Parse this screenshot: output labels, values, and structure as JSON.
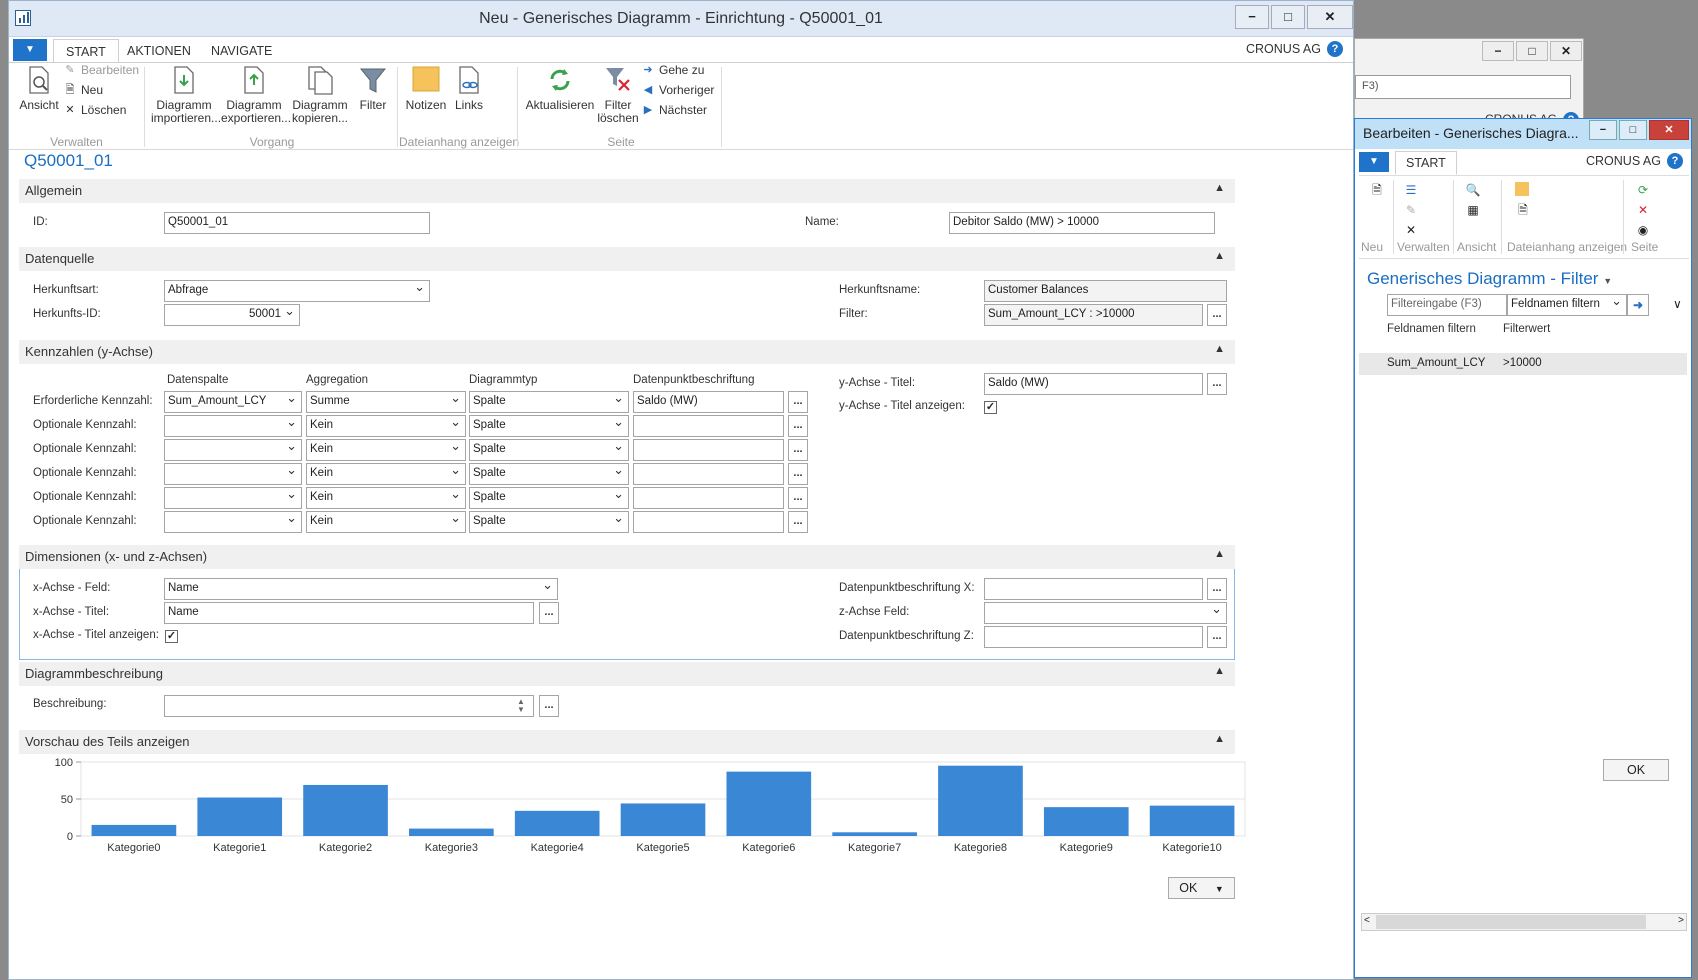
{
  "bg_window": {
    "search_placeholder": "F3)",
    "company": "CRONUS AG"
  },
  "main_window": {
    "title": "Neu - Generisches Diagramm - Einrichtung - Q50001_01",
    "buttons": {
      "minimize": "−",
      "maximize": "□",
      "close": "✕"
    },
    "tabs": [
      "START",
      "AKTIONEN",
      "NAVIGATE"
    ],
    "company": "CRONUS AG",
    "help": "?"
  },
  "ribbon": {
    "verwalten": {
      "label": "Verwalten",
      "ansicht": "Ansicht",
      "bearbeiten": "Bearbeiten",
      "neu": "Neu",
      "loeschen": "Löschen"
    },
    "vorgang": {
      "label": "Vorgang",
      "import_l1": "Diagramm",
      "import_l2": "importieren...",
      "export_l1": "Diagramm",
      "export_l2": "exportieren...",
      "copy_l1": "Diagramm",
      "copy_l2": "kopieren...",
      "filter": "Filter"
    },
    "dateianhang": {
      "label": "Dateianhang anzeigen",
      "notizen": "Notizen",
      "links": "Links"
    },
    "seite": {
      "label": "Seite",
      "aktualisieren": "Aktualisieren",
      "filter_l1": "Filter",
      "filter_l2": "löschen",
      "gehe_zu": "Gehe zu",
      "vorheriger": "Vorheriger",
      "naechster": "Nächster"
    }
  },
  "page_title": "Q50001_01",
  "allgemein": {
    "header": "Allgemein",
    "id_label": "ID:",
    "id_value": "Q50001_01",
    "name_label": "Name:",
    "name_value": "Debitor Saldo (MW) > 10000"
  },
  "datenquelle": {
    "header": "Datenquelle",
    "herkunftsart_label": "Herkunftsart:",
    "herkunftsart_value": "Abfrage",
    "herkunfts_id_label": "Herkunfts-ID:",
    "herkunfts_id_value": "50001",
    "herkunftsname_label": "Herkunftsname:",
    "herkunftsname_value": "Customer Balances",
    "filter_label": "Filter:",
    "filter_value": "Sum_Amount_LCY : >10000"
  },
  "kennzahlen": {
    "header": "Kennzahlen (y-Achse)",
    "col_datenspalte": "Datenspalte",
    "col_aggregation": "Aggregation",
    "col_diagrammtyp": "Diagrammtyp",
    "col_beschriftung": "Datenpunktbeschriftung",
    "rows": [
      {
        "label": "Erforderliche Kennzahl:",
        "datenspalte": "Sum_Amount_LCY",
        "aggregation": "Summe",
        "diagrammtyp": "Spalte",
        "beschriftung": "Saldo (MW)"
      },
      {
        "label": "Optionale Kennzahl:",
        "datenspalte": "",
        "aggregation": "Kein",
        "diagrammtyp": "Spalte",
        "beschriftung": ""
      },
      {
        "label": "Optionale Kennzahl:",
        "datenspalte": "",
        "aggregation": "Kein",
        "diagrammtyp": "Spalte",
        "beschriftung": ""
      },
      {
        "label": "Optionale Kennzahl:",
        "datenspalte": "",
        "aggregation": "Kein",
        "diagrammtyp": "Spalte",
        "beschriftung": ""
      },
      {
        "label": "Optionale Kennzahl:",
        "datenspalte": "",
        "aggregation": "Kein",
        "diagrammtyp": "Spalte",
        "beschriftung": ""
      },
      {
        "label": "Optionale Kennzahl:",
        "datenspalte": "",
        "aggregation": "Kein",
        "diagrammtyp": "Spalte",
        "beschriftung": ""
      }
    ],
    "ytitle_label": "y-Achse - Titel:",
    "ytitle_value": "Saldo (MW)",
    "ytitle_show_label": "y-Achse - Titel anzeigen:",
    "ytitle_show_checked": "✓"
  },
  "dimensionen": {
    "header": "Dimensionen (x- und z-Achsen)",
    "xfeld_label": "x-Achse - Feld:",
    "xfeld_value": "Name",
    "xtitel_label": "x-Achse - Titel:",
    "xtitel_value": "Name",
    "xtitel_show_label": "x-Achse - Titel anzeigen:",
    "xtitel_show_checked": "✓",
    "dpx_label": "Datenpunktbeschriftung X:",
    "zfeld_label": "z-Achse Feld:",
    "dpz_label": "Datenpunktbeschriftung Z:"
  },
  "beschreibung": {
    "header": "Diagrammbeschreibung",
    "label": "Beschreibung:"
  },
  "vorschau": {
    "header": "Vorschau des Teils anzeigen"
  },
  "chart_data": {
    "type": "bar",
    "categories": [
      "Kategorie0",
      "Kategorie1",
      "Kategorie2",
      "Kategorie3",
      "Kategorie4",
      "Kategorie5",
      "Kategorie6",
      "Kategorie7",
      "Kategorie8",
      "Kategorie9",
      "Kategorie10"
    ],
    "values": [
      15,
      52,
      69,
      10,
      34,
      44,
      87,
      5,
      95,
      39,
      41
    ],
    "ylim": [
      0,
      100
    ],
    "yticks": [
      0,
      50,
      100
    ],
    "color": "#3a87d6",
    "grid": true
  },
  "ok_label": "OK",
  "dialog": {
    "title": "Bearbeiten - Generisches Diagra...",
    "tab": "START",
    "company": "CRONUS AG",
    "groups": [
      "Neu",
      "Verwalten",
      "Ansicht",
      "Dateianhang anzeigen",
      "Seite"
    ],
    "heading": "Generisches Diagramm - Filter",
    "filter_placeholder": "Filtereingabe (F3)",
    "filter_field_select": "Feldnamen filtern",
    "col_field": "Feldnamen filtern",
    "col_value": "Filterwert",
    "row_field": "Sum_Amount_LCY",
    "row_value": ">10000",
    "ok": "OK"
  }
}
